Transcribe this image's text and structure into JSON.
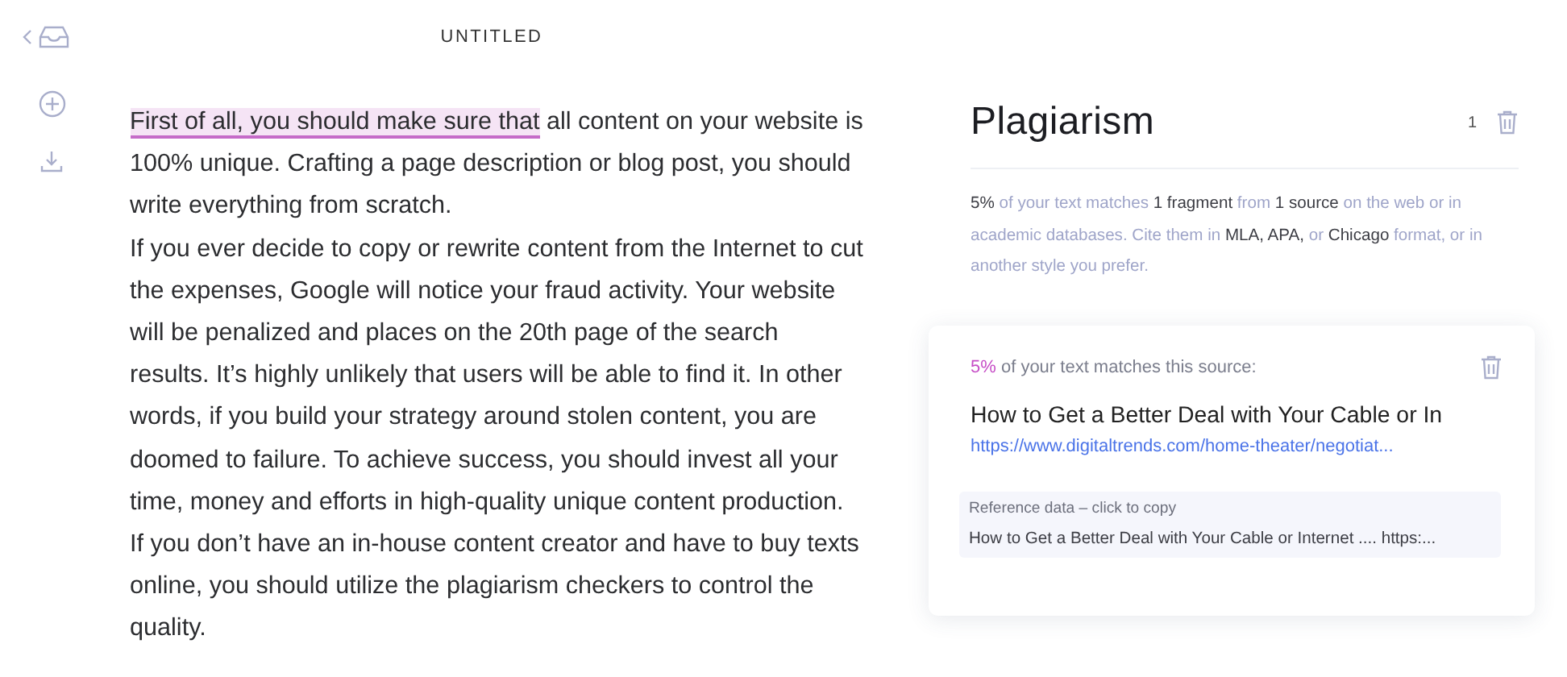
{
  "document": {
    "title": "UNTITLED",
    "paragraphs": [
      {
        "highlight": "First of all, you should make sure that",
        "text": " all content on your website is 100% unique. Crafting a page description or blog post, you should write everything from scratch."
      },
      {
        "text": "If you ever decide to copy or rewrite content from the Internet to cut the expenses, Google will notice your fraud activity. Your website will be penalized and places on the 20th page of the search results. It’s highly unlikely that users will be able to find it. In other words, if you build your strategy around stolen content, you are doomed to failure. To achieve success, you should invest all your time, money and efforts in high-quality unique content production. If you don’t have an in-house content creator and have to buy texts online, you should utilize the plagiarism checkers to control the quality."
      }
    ]
  },
  "panel": {
    "title": "Plagiarism",
    "count": "1",
    "summary": "**5%** of your text matches **1 fragment** from **1 source** on the web or in academic databases. Cite them in **MLA, APA,** or **Chicago** format, or in another style you prefer.",
    "source": {
      "percent": "5%",
      "text": " of your text matches this source:",
      "title": "How to Get a Better Deal with Your Cable or In",
      "url": "https://www.digitaltrends.com/home-theater/negotiat...",
      "reference_label": "Reference data – click to copy",
      "reference": "How to Get a Better Deal with Your Cable or Internet .... https:..."
    }
  }
}
